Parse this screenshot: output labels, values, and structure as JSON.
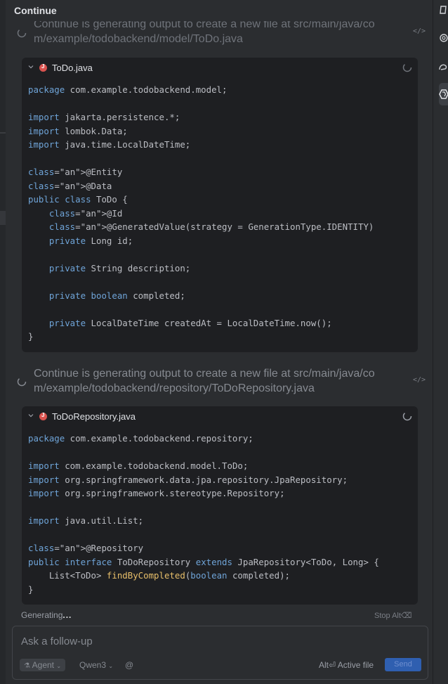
{
  "panel": {
    "title": "Continue"
  },
  "steps": [
    {
      "status": "Continue is generating output to create a new file at src/main/java/com/example/todobackend/model/ToDo.java",
      "status_line1": "Continue is generating output to create a new file at src/main/java/co",
      "status_line2": "m/example/todobackend/model/ToDo.java",
      "code_icon": "</>",
      "file": {
        "name": "ToDo.java",
        "icon": "java-file-icon"
      }
    },
    {
      "status": "Continue is generating output to create a new file at src/main/java/com/example/todobackend/repository/ToDoRepository.java",
      "status_line1": "Continue is generating output to create a new file at src/main/java/co",
      "status_line2": "m/example/todobackend/repository/ToDoRepository.java",
      "code_icon": "</>",
      "file": {
        "name": "ToDoRepository.java",
        "icon": "java-file-icon"
      }
    }
  ],
  "code": {
    "todo_java": [
      "package com.example.todobackend.model;",
      "",
      "import jakarta.persistence.*;",
      "import lombok.Data;",
      "import java.time.LocalDateTime;",
      "",
      "@Entity",
      "@Data",
      "public class ToDo {",
      "    @Id",
      "    @GeneratedValue(strategy = GenerationType.IDENTITY)",
      "    private Long id;",
      "",
      "    private String description;",
      "",
      "    private boolean completed;",
      "",
      "    private LocalDateTime createdAt = LocalDateTime.now();",
      "}"
    ],
    "repository_java": [
      "package com.example.todobackend.repository;",
      "",
      "import com.example.todobackend.model.ToDo;",
      "import org.springframework.data.jpa.repository.JpaRepository;",
      "import org.springframework.stereotype.Repository;",
      "",
      "import java.util.List;",
      "",
      "@Repository",
      "public interface ToDoRepository extends JpaRepository<ToDo, Long> {",
      "    List<ToDo> findByCompleted(boolean completed);",
      "}"
    ]
  },
  "footer": {
    "generating_label": "Generating",
    "generating_dots": "...",
    "stop_label": "Stop",
    "stop_shortcut": "Alt⌫"
  },
  "input": {
    "placeholder": "Ask a follow-up",
    "mode_label": "Agent",
    "model_label": "Qwen3",
    "at_symbol": "@",
    "active_file_shortcut": "Alt⏎",
    "active_file_label": "Active file",
    "send_label": "Send"
  },
  "colors": {
    "background": "#2b2d30",
    "code_background": "#1e1f22",
    "keyword": "#6fa4d8",
    "method": "#e8bf6a",
    "send_button": "#2f5fb0",
    "java_icon": "#d9534f"
  }
}
